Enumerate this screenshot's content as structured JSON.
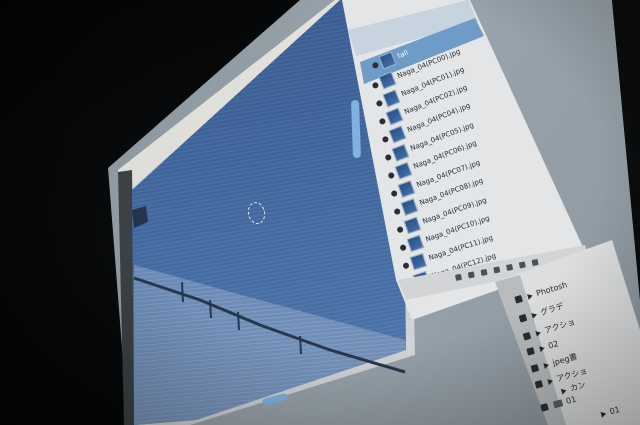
{
  "file_panel": {
    "files": [
      {
        "name": "tall",
        "selected": true
      },
      {
        "name": "Naga_04(PC00).jpg",
        "selected": false
      },
      {
        "name": "Naga_04(PC01).jpg",
        "selected": false
      },
      {
        "name": "Naga_04(PC02).jpg",
        "selected": false
      },
      {
        "name": "Naga_04(PC04).jpg",
        "selected": false
      },
      {
        "name": "Naga_04(PC05).jpg",
        "selected": false
      },
      {
        "name": "Naga_04(PC06).jpg",
        "selected": false
      },
      {
        "name": "Naga_04(PC07).jpg",
        "selected": false
      },
      {
        "name": "Naga_04(PC08).jpg",
        "selected": false
      },
      {
        "name": "Naga_04(PC09).jpg",
        "selected": false
      },
      {
        "name": "Naga_04(PC10).jpg",
        "selected": false
      },
      {
        "name": "Naga_04(PC11).jpg",
        "selected": false
      },
      {
        "name": "Naga_04(PC12).jpg",
        "selected": false
      }
    ]
  },
  "layers_panel": {
    "items": [
      {
        "label": "Photosh",
        "kind": "action"
      },
      {
        "label": "グラデ",
        "kind": "action"
      },
      {
        "label": "アクショ",
        "kind": "action"
      },
      {
        "label": "02",
        "kind": "action"
      },
      {
        "label": "jpeg書",
        "kind": "action"
      },
      {
        "label": "アクショ",
        "kind": "action"
      },
      {
        "label": "カン",
        "kind": "action"
      },
      {
        "label": "01",
        "kind": "folder"
      },
      {
        "label": "01",
        "kind": "action"
      }
    ]
  },
  "colors": {
    "canvas_sky": "#4168a0",
    "selection_highlight": "#6f9bc9",
    "scroll_thumb": "#7fb2e0",
    "panel_bg": "#e3e5e6"
  }
}
